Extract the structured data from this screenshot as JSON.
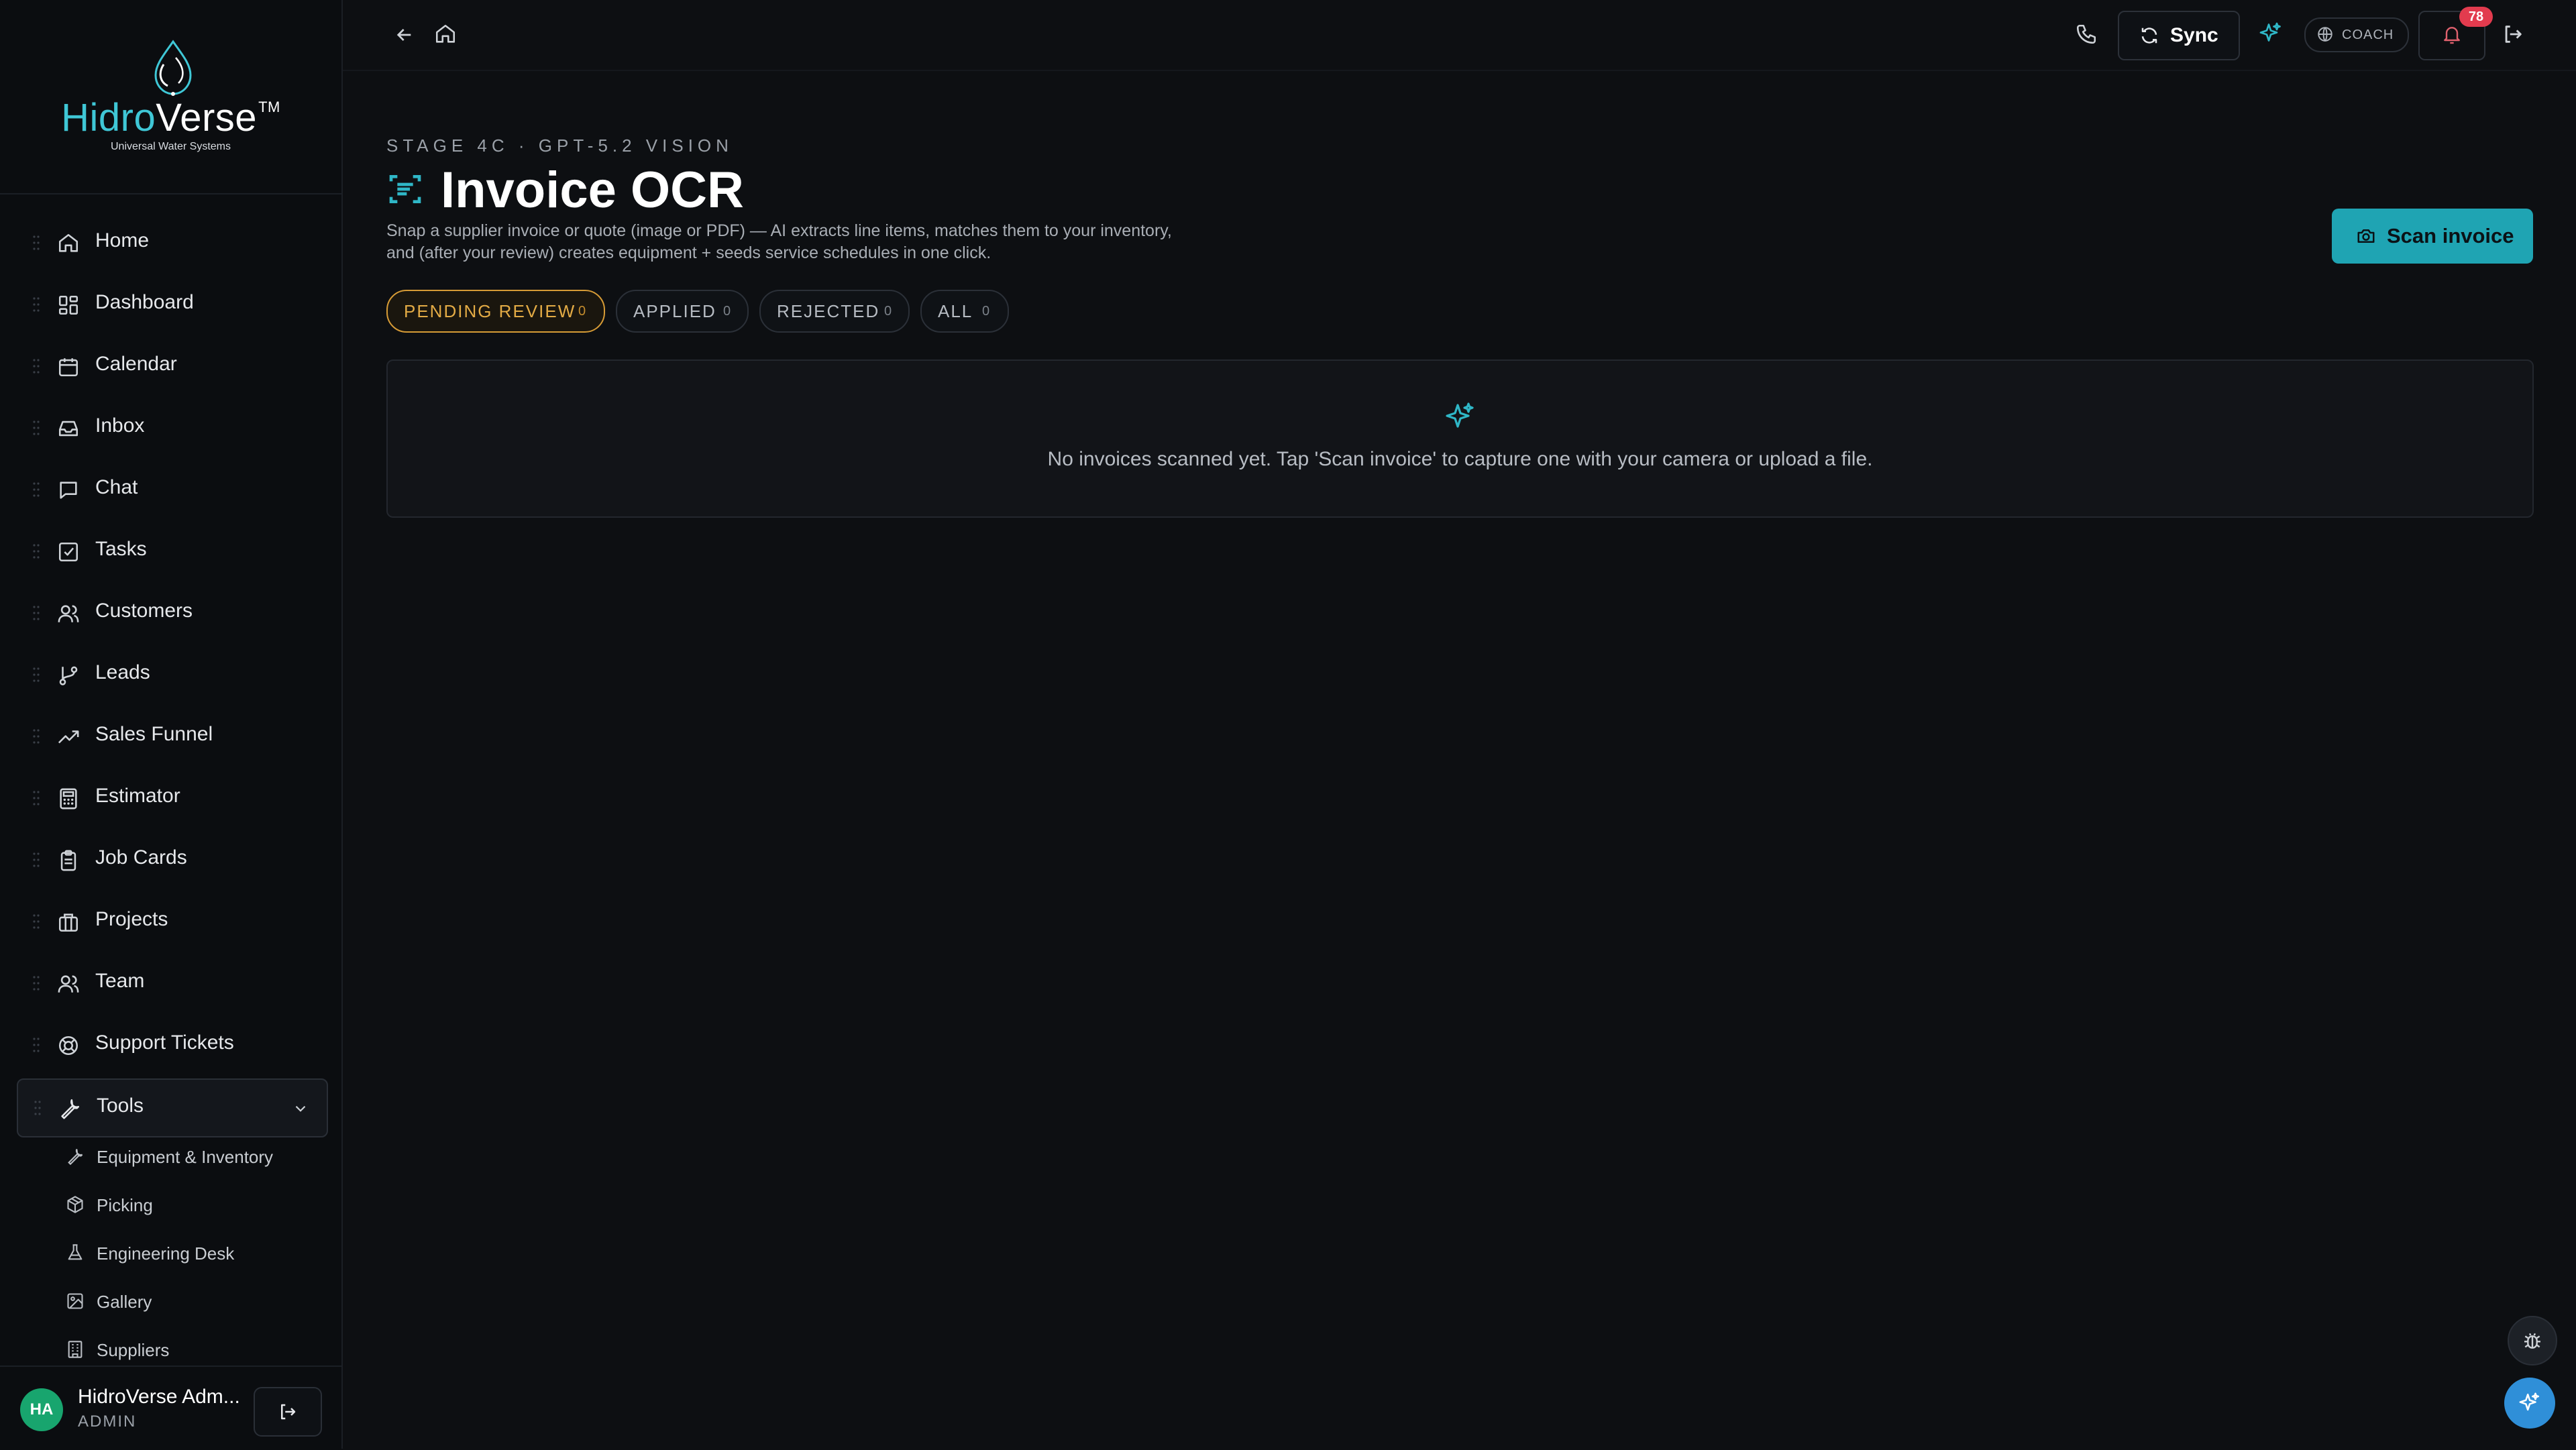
{
  "brand": {
    "name_part1": "Hidro",
    "name_part2": "Verse",
    "trademark": "TM",
    "tagline": "Universal Water Systems"
  },
  "sidebar": {
    "items": [
      {
        "label": "Home",
        "icon": "home-icon"
      },
      {
        "label": "Dashboard",
        "icon": "dashboard-icon"
      },
      {
        "label": "Calendar",
        "icon": "calendar-icon"
      },
      {
        "label": "Inbox",
        "icon": "inbox-icon"
      },
      {
        "label": "Chat",
        "icon": "chat-icon"
      },
      {
        "label": "Tasks",
        "icon": "tasks-icon"
      },
      {
        "label": "Customers",
        "icon": "users-icon"
      },
      {
        "label": "Leads",
        "icon": "git-branch-icon"
      },
      {
        "label": "Sales Funnel",
        "icon": "trending-up-icon"
      },
      {
        "label": "Estimator",
        "icon": "calculator-icon"
      },
      {
        "label": "Job Cards",
        "icon": "clipboard-icon"
      },
      {
        "label": "Projects",
        "icon": "briefcase-icon"
      },
      {
        "label": "Team",
        "icon": "team-icon"
      },
      {
        "label": "Support Tickets",
        "icon": "lifebuoy-icon"
      },
      {
        "label": "Tools",
        "icon": "wrench-icon",
        "expanded": true
      }
    ],
    "tools_children": [
      {
        "label": "Equipment & Inventory",
        "icon": "wrench-icon"
      },
      {
        "label": "Picking",
        "icon": "package-icon"
      },
      {
        "label": "Engineering Desk",
        "icon": "flask-icon"
      },
      {
        "label": "Gallery",
        "icon": "image-icon"
      },
      {
        "label": "Suppliers",
        "icon": "building-icon"
      }
    ],
    "user": {
      "initials": "HA",
      "name": "HidroVerse Adm...",
      "role": "ADMIN"
    }
  },
  "topbar": {
    "sync_label": "Sync",
    "coach_label": "COACH",
    "notification_count": "78"
  },
  "page": {
    "eyebrow": "STAGE 4C · GPT-5.2 VISION",
    "title": "Invoice OCR",
    "description": "Snap a supplier invoice or quote (image or PDF) — AI extracts line items, matches them to your inventory, and (after your review) creates equipment + seeds service schedules in one click.",
    "scan_button_label": "Scan invoice",
    "tabs": [
      {
        "label": "PENDING REVIEW",
        "count": "0",
        "active": true
      },
      {
        "label": "APPLIED",
        "count": "0",
        "active": false
      },
      {
        "label": "REJECTED",
        "count": "0",
        "active": false
      },
      {
        "label": "ALL",
        "count": "0",
        "active": false
      }
    ],
    "empty_message": "No invoices scanned yet. Tap 'Scan invoice' to capture one with your camera or upload a file."
  },
  "colors": {
    "accent": "#1fa4b3",
    "active_tab": "#d69b36",
    "badge": "#e23b4e",
    "avatar": "#18a56e"
  }
}
